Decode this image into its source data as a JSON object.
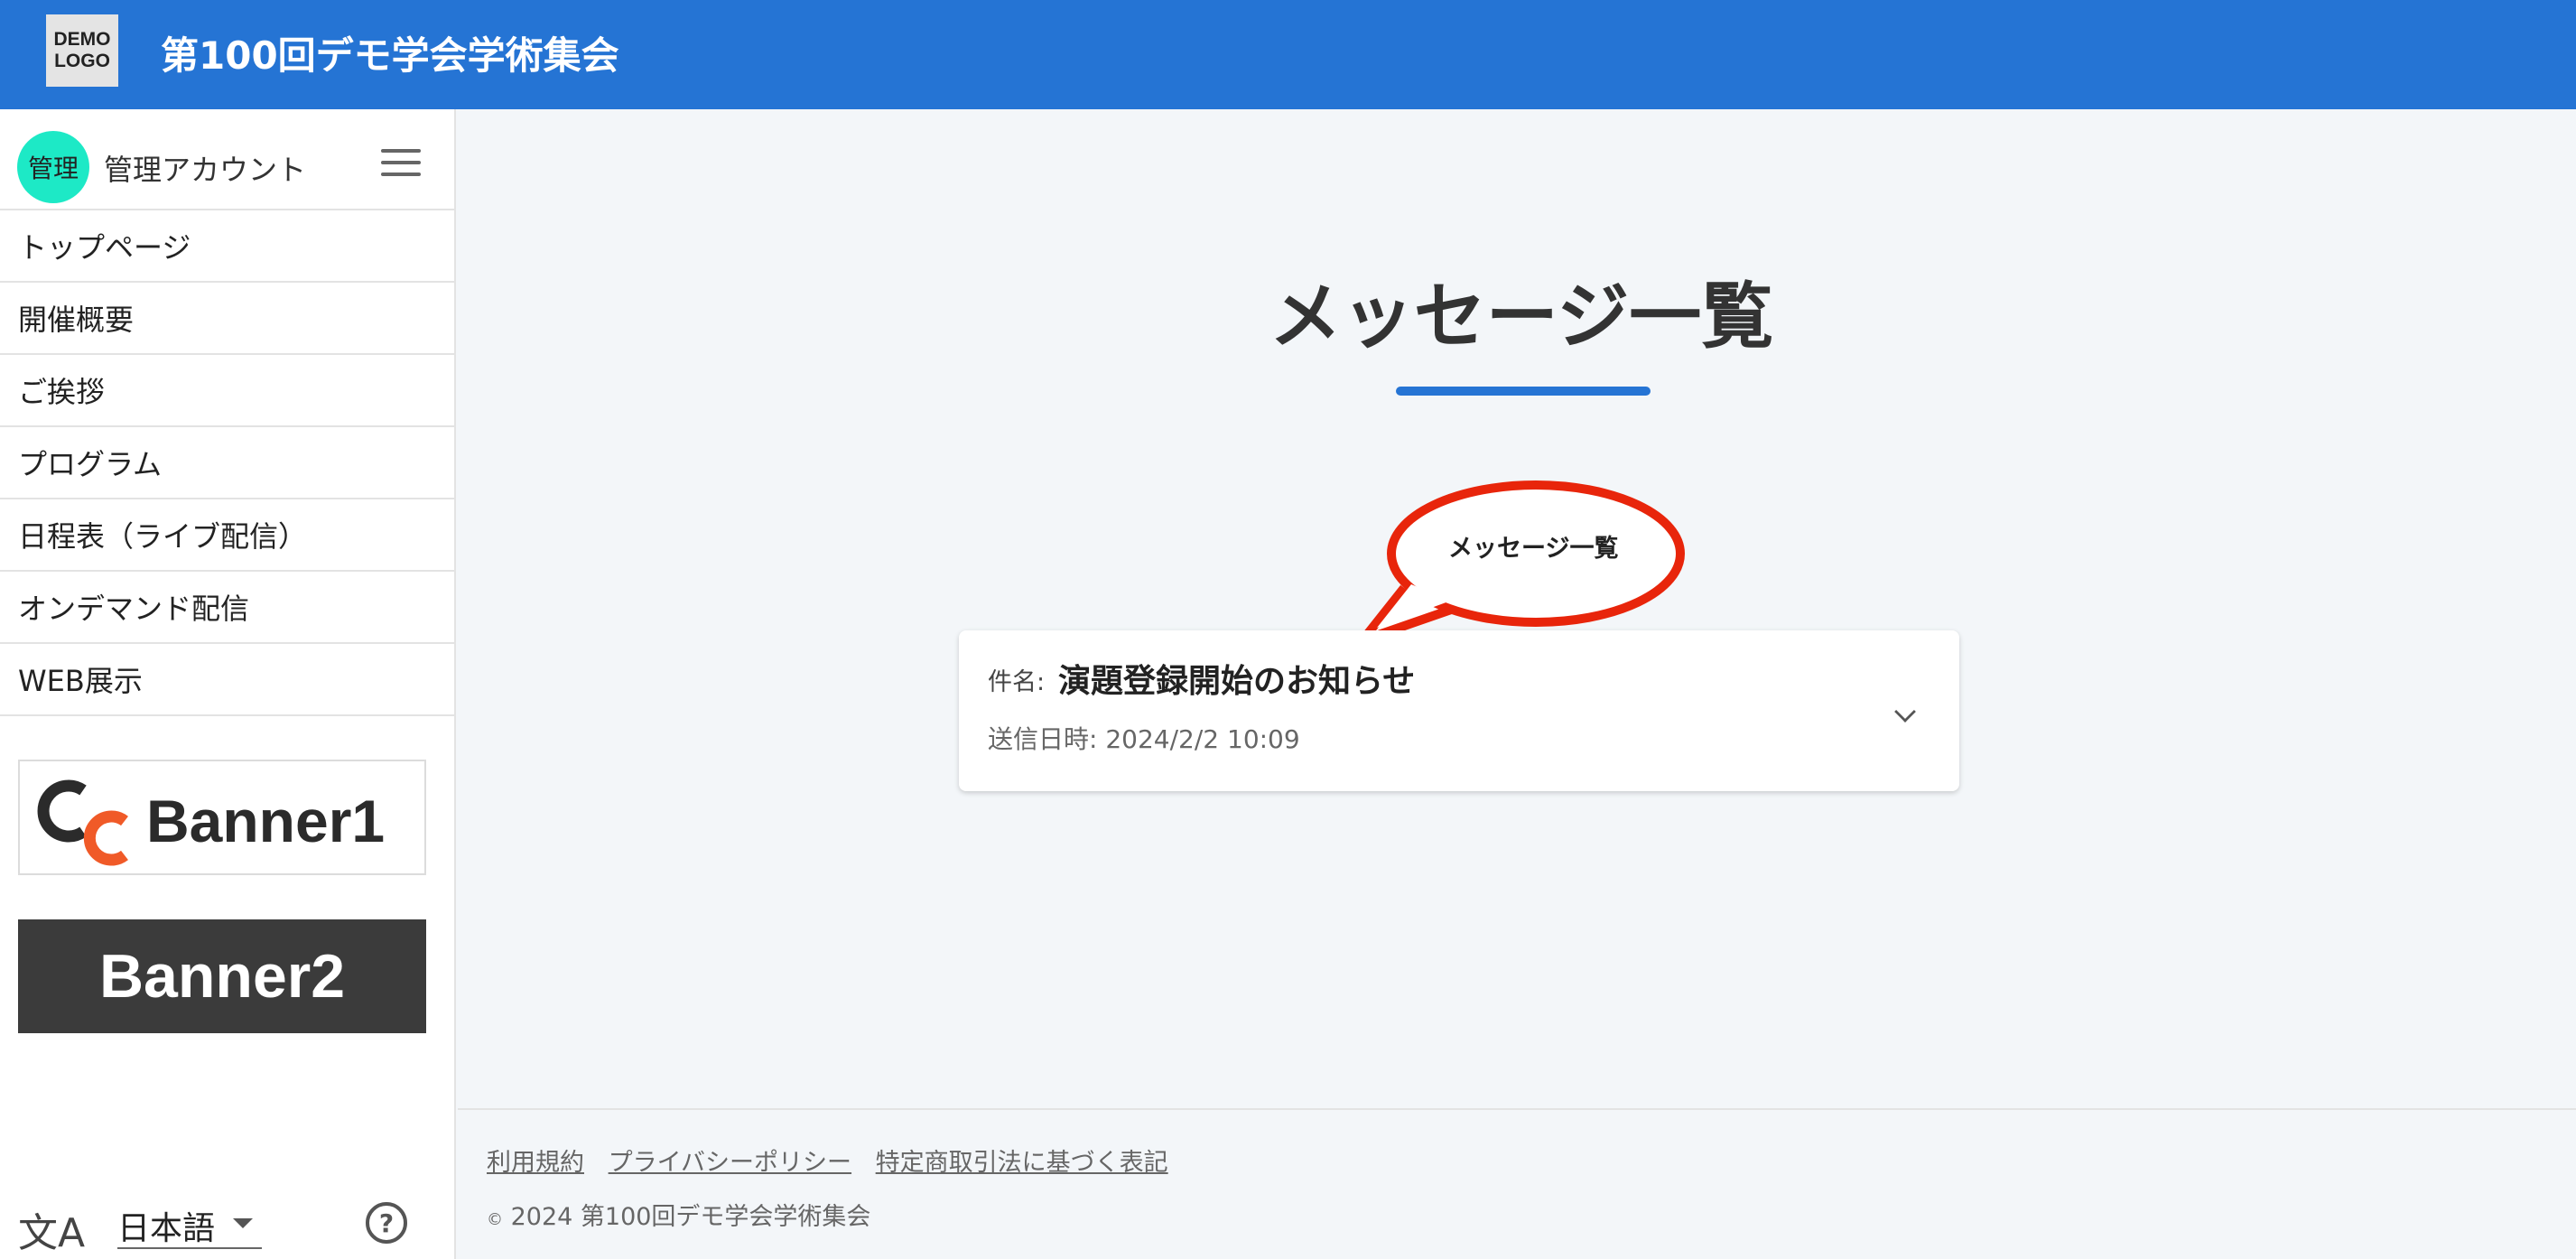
{
  "header": {
    "logo_line1": "DEMO",
    "logo_line2": "LOGO",
    "title": "第100回デモ学会学術集会",
    "color": "#2574d4"
  },
  "sidebar": {
    "account": {
      "avatar_text": "管理",
      "name": "管理アカウント",
      "avatar_color": "#1de9c6"
    },
    "menu_icon": "hamburger-icon",
    "items": [
      {
        "label": "トップページ"
      },
      {
        "label": "開催概要"
      },
      {
        "label": "ご挨拶"
      },
      {
        "label": "プログラム"
      },
      {
        "label": "日程表（ライブ配信）"
      },
      {
        "label": "オンデマンド配信"
      },
      {
        "label": "WEB展示"
      }
    ],
    "banners": [
      {
        "label": "Banner1",
        "logo_letters": "CC"
      },
      {
        "label": "Banner2"
      }
    ],
    "footer": {
      "lang_icon": "translate-icon",
      "language": "日本語",
      "help_icon": "help-icon"
    }
  },
  "main": {
    "title": "メッセージ一覧",
    "callout": "メッセージ一覧",
    "messages": [
      {
        "subject_label": "件名:",
        "subject": "演題登録開始のお知らせ",
        "sent_label": "送信日時:",
        "sent_at": "2024/2/2 10:09"
      }
    ]
  },
  "footer": {
    "links": [
      {
        "label": "利用規約"
      },
      {
        "label": "プライバシーポリシー"
      },
      {
        "label": "特定商取引法に基づく表記"
      }
    ],
    "copyright_symbol": "©",
    "copyright": "2024 第100回デモ学会学術集会"
  }
}
